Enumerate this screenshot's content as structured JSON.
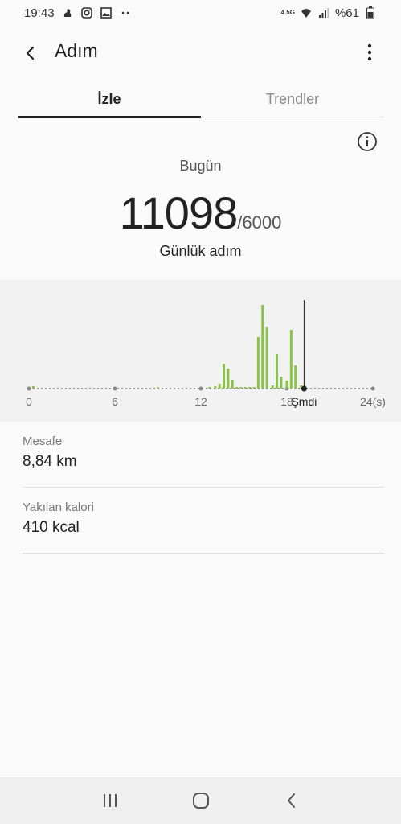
{
  "status_bar": {
    "time": "19:43",
    "network": "4.5G",
    "battery": "%61",
    "icons": [
      "notification-icon",
      "instagram-icon",
      "gallery-icon",
      "more-dots-icon",
      "wifi-icon",
      "signal-icon",
      "battery-icon"
    ]
  },
  "header": {
    "title": "Adım",
    "back_icon": "chevron-left-icon",
    "more_icon": "more-vertical-icon"
  },
  "tabs": [
    {
      "label": "İzle",
      "active": true
    },
    {
      "label": "Trendler",
      "active": false
    }
  ],
  "info_icon": "info-icon",
  "summary": {
    "period_label": "Bugün",
    "steps": "11098",
    "goal": "/6000",
    "steps_label": "Günlük adım"
  },
  "chart_data": {
    "type": "bar",
    "x_ticks": [
      "0",
      "6",
      "12",
      "18"
    ],
    "x_end_label": "24(s)",
    "now_label": "Şmdi",
    "now_hour": 19.2,
    "bar_color": "#8bc34a",
    "bars": [
      {
        "hour": 0.3,
        "value": 30
      },
      {
        "hour": 9.0,
        "value": 20
      },
      {
        "hour": 12.6,
        "value": 20
      },
      {
        "hour": 13.0,
        "value": 30
      },
      {
        "hour": 13.3,
        "value": 60
      },
      {
        "hour": 13.6,
        "value": 310
      },
      {
        "hour": 13.9,
        "value": 250
      },
      {
        "hour": 14.2,
        "value": 110
      },
      {
        "hour": 14.5,
        "value": 20
      },
      {
        "hour": 14.8,
        "value": 20
      },
      {
        "hour": 15.1,
        "value": 20
      },
      {
        "hour": 15.4,
        "value": 20
      },
      {
        "hour": 15.7,
        "value": 20
      },
      {
        "hour": 16.0,
        "value": 640
      },
      {
        "hour": 16.3,
        "value": 1040
      },
      {
        "hour": 16.6,
        "value": 770
      },
      {
        "hour": 17.0,
        "value": 40
      },
      {
        "hour": 17.3,
        "value": 430
      },
      {
        "hour": 17.6,
        "value": 150
      },
      {
        "hour": 18.0,
        "value": 100
      },
      {
        "hour": 18.3,
        "value": 730
      },
      {
        "hour": 18.6,
        "value": 290
      },
      {
        "hour": 19.0,
        "value": 40
      }
    ],
    "ymax": 1100
  },
  "stats": [
    {
      "label": "Mesafe",
      "value": "8,84 km"
    },
    {
      "label": "Yakılan kalori",
      "value": "410 kcal"
    }
  ],
  "nav": {
    "recent_icon": "recent-apps-icon",
    "home_icon": "home-icon",
    "back_icon": "back-icon"
  }
}
